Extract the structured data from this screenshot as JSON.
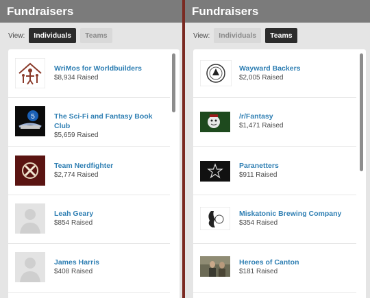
{
  "left": {
    "header": "Fundraisers",
    "view_label": "View:",
    "tabs": [
      "Individuals",
      "Teams"
    ],
    "active_tab": "Individuals",
    "items": [
      {
        "name": "WriMos for Worldbuilders",
        "amount": "$8,934 Raised",
        "icon": "family-logo-icon"
      },
      {
        "name": "The Sci-Fi and Fantasy Book Club",
        "amount": "$5,659 Raised",
        "icon": "book-club-logo-icon"
      },
      {
        "name": "Team Nerdfighter",
        "amount": "$2,774 Raised",
        "icon": "nerdfighter-logo-icon"
      },
      {
        "name": "Leah Geary",
        "amount": "$854 Raised",
        "icon": "default-avatar-icon"
      },
      {
        "name": "James Harris",
        "amount": "$408 Raised",
        "icon": "default-avatar-icon"
      }
    ]
  },
  "right": {
    "header": "Fundraisers",
    "view_label": "View:",
    "tabs": [
      "Individuals",
      "Teams"
    ],
    "active_tab": "Teams",
    "items": [
      {
        "name": "Wayward Backers",
        "amount": "$2,005 Raised",
        "icon": "seal-logo-icon"
      },
      {
        "name": "/r/Fantasy",
        "amount": "$1,471 Raised",
        "icon": "r-fantasy-logo-icon"
      },
      {
        "name": "Paranetters",
        "amount": "$911 Raised",
        "icon": "star-logo-icon"
      },
      {
        "name": "Miskatonic Brewing Company",
        "amount": "$354 Raised",
        "icon": "brewing-logo-icon"
      },
      {
        "name": "Heroes of Canton",
        "amount": "$181 Raised",
        "icon": "photo-thumbnail-icon"
      }
    ]
  }
}
